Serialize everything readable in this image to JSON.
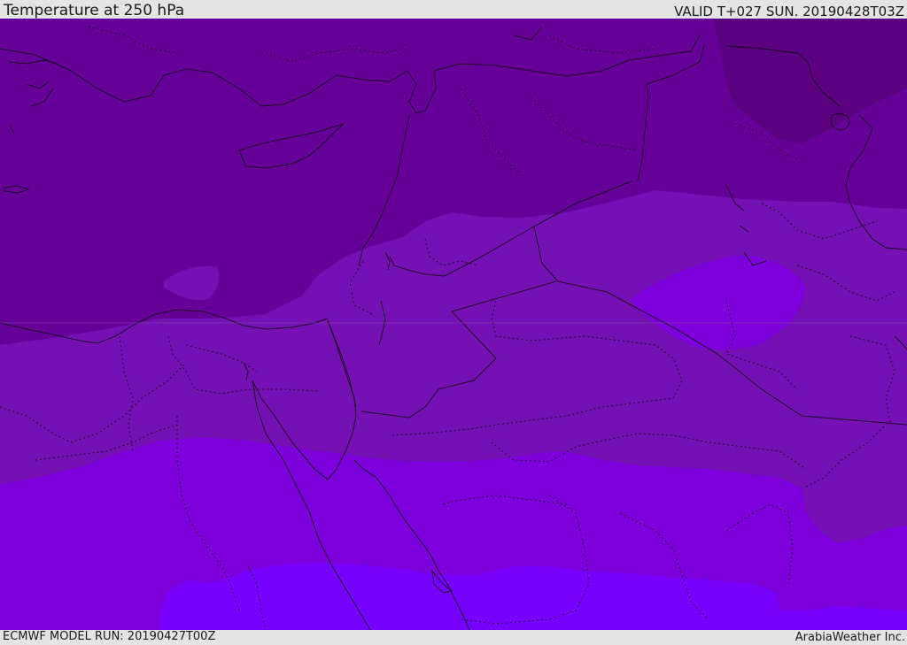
{
  "header": {
    "title": "Temperature at 250 hPa",
    "valid_time": "VALID T+027 SUN. 20190428T03Z"
  },
  "footer": {
    "model_run": "ECMWF MODEL RUN: 20190427T00Z",
    "credit": "ArabiaWeather Inc."
  },
  "map": {
    "variable": "temperature",
    "level": "250 hPa",
    "colors": {
      "band_coldest": "#5a0080",
      "band_cold": "#660099",
      "band_mid": "#7410b4",
      "band_warm": "#7d00dd",
      "band_warmest": "#7700ff",
      "coast_line": "#1a0026",
      "border_line": "#1a0026"
    }
  }
}
